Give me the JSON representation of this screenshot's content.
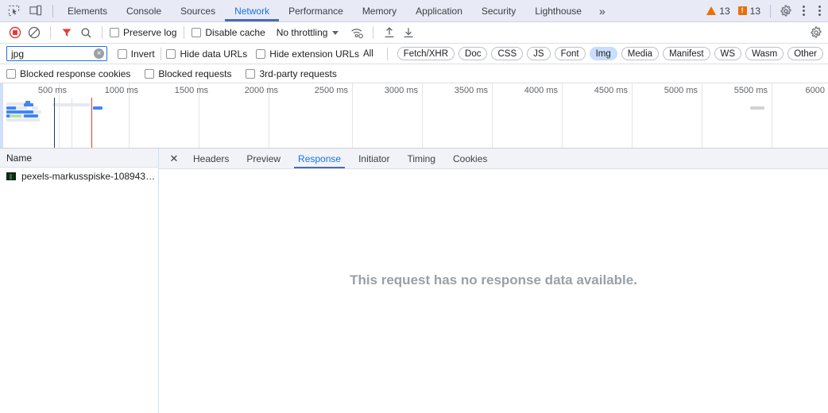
{
  "devtools": {
    "left_icons": [
      {
        "name": "inspect-element-icon",
        "label": "Inspect element"
      },
      {
        "name": "device-toolbar-icon",
        "label": "Toggle device toolbar"
      }
    ],
    "tabs": [
      {
        "label": "Elements",
        "active": false
      },
      {
        "label": "Console",
        "active": false
      },
      {
        "label": "Sources",
        "active": false
      },
      {
        "label": "Network",
        "active": true
      },
      {
        "label": "Performance",
        "active": false
      },
      {
        "label": "Memory",
        "active": false
      },
      {
        "label": "Application",
        "active": false
      },
      {
        "label": "Security",
        "active": false
      },
      {
        "label": "Lighthouse",
        "active": false
      }
    ],
    "more_tabs_label": "»",
    "warnings_count": "13",
    "errors_count": "13",
    "error_glyph": "!",
    "settings_icon_label": "Settings",
    "kebab_label": "Customize and control DevTools",
    "accent_color": "#1a73e8",
    "warning_color": "#e8710a"
  },
  "network_toolbar": {
    "record_label": "Stop recording network log",
    "clear_label": "Clear",
    "filter_icon_label": "Filter",
    "search_icon_label": "Search",
    "preserve_log": {
      "label": "Preserve log",
      "checked": false
    },
    "disable_cache": {
      "label": "Disable cache",
      "checked": false
    },
    "throttling": {
      "value": "No throttling",
      "caret": "▾"
    },
    "network_conditions_label": "Network conditions",
    "import_label": "Import HAR file",
    "export_label": "Export HAR file",
    "record_color": "#e53935",
    "filter_active_color": "#e53935"
  },
  "filter_bar": {
    "input": {
      "value": "jpg",
      "placeholder": "Filter",
      "clear_glyph": "×"
    },
    "invert": {
      "label": "Invert",
      "checked": false
    },
    "hide_data_urls": {
      "label": "Hide data URLs",
      "checked": false
    },
    "hide_extension_urls": {
      "label": "Hide extension URLs",
      "checked": false
    },
    "type_chips": [
      {
        "label": "All",
        "selected": false,
        "plain": true
      },
      {
        "label": "Fetch/XHR",
        "selected": false
      },
      {
        "label": "Doc",
        "selected": false
      },
      {
        "label": "CSS",
        "selected": false
      },
      {
        "label": "JS",
        "selected": false
      },
      {
        "label": "Font",
        "selected": false
      },
      {
        "label": "Img",
        "selected": true
      },
      {
        "label": "Media",
        "selected": false
      },
      {
        "label": "Manifest",
        "selected": false
      },
      {
        "label": "WS",
        "selected": false
      },
      {
        "label": "Wasm",
        "selected": false
      },
      {
        "label": "Other",
        "selected": false
      }
    ],
    "selected_chip_color": "#c9ddfc"
  },
  "filter_bar2": {
    "blocked_response_cookies": {
      "label": "Blocked response cookies",
      "checked": false
    },
    "blocked_requests": {
      "label": "Blocked requests",
      "checked": false
    },
    "third_party_requests": {
      "label": "3rd-party requests",
      "checked": false
    }
  },
  "overview": {
    "tick_labels": [
      "500 ms",
      "1000 ms",
      "1500 ms",
      "2000 ms",
      "2500 ms",
      "3000 ms",
      "3500 ms",
      "4000 ms",
      "4500 ms",
      "5000 ms",
      "5500 ms",
      "6000"
    ],
    "dom_content_loaded_ms": 500,
    "load_event_ms": 830,
    "dcl_color": "#1f3864",
    "load_color": "#e53935"
  },
  "request_table": {
    "column_name": "Name",
    "rows": [
      {
        "name": "pexels-markusspiske-108943…",
        "type": "image"
      }
    ]
  },
  "details_panel": {
    "close_glyph": "✕",
    "tabs": [
      {
        "label": "Headers",
        "active": false
      },
      {
        "label": "Preview",
        "active": false
      },
      {
        "label": "Response",
        "active": true
      },
      {
        "label": "Initiator",
        "active": false
      },
      {
        "label": "Timing",
        "active": false
      },
      {
        "label": "Cookies",
        "active": false
      }
    ],
    "empty_message": "This request has no response data available."
  }
}
